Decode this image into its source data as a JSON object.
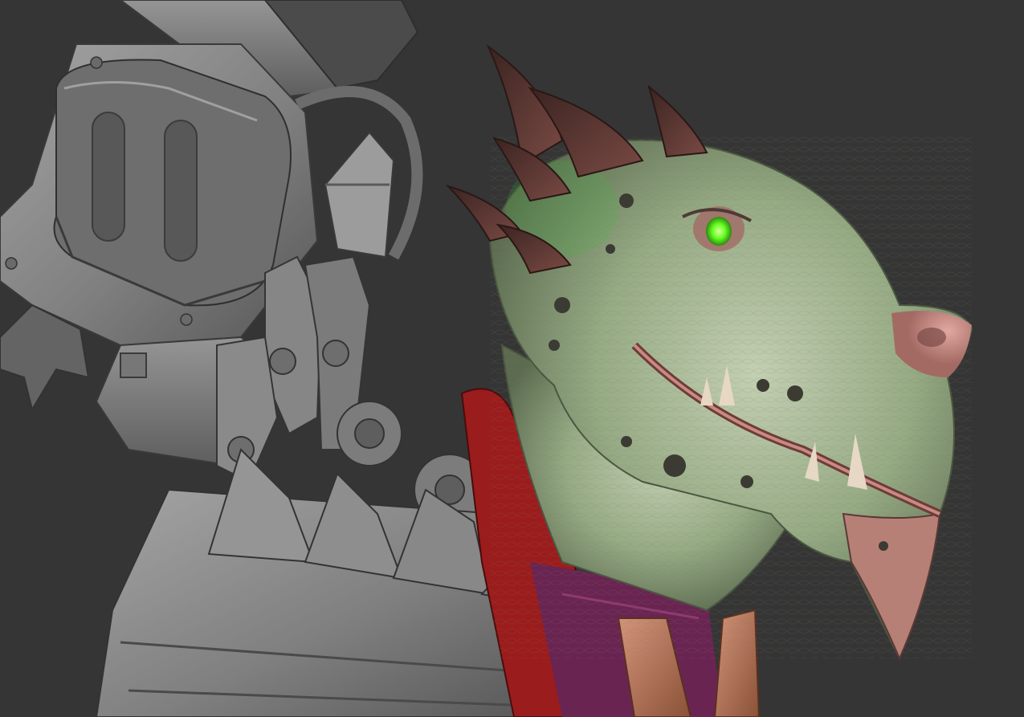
{
  "scene": {
    "subject": "",
    "colors": {
      "background": "#353535",
      "clay_light": "#9a9a9a",
      "clay_mid": "#7a7a7a",
      "clay_dark": "#4e4e4e",
      "skin_light": "#b8c6a8",
      "skin_mid": "#8fa37e",
      "skin_dark": "#5e6e52",
      "skin_pink": "#c98a84",
      "horn": "#5a3a36",
      "eye": "#66ff22",
      "collar_red": "#9b1c1c",
      "cloth_purple": "#6a2452",
      "leather": "#b57656"
    }
  }
}
